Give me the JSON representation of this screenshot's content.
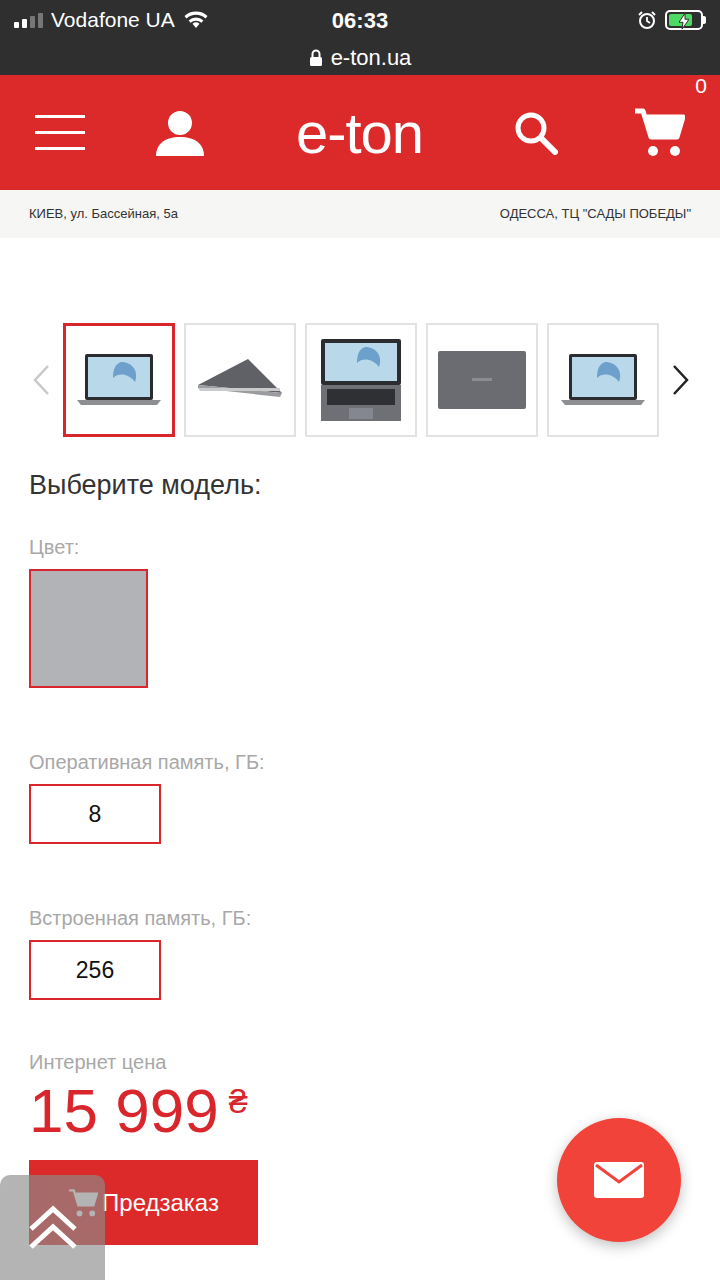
{
  "status_bar": {
    "carrier": "Vodafone UA",
    "time": "06:33",
    "url": "e-ton.ua",
    "signal_level": 0.5,
    "battery_level": 0.75,
    "charging": true,
    "alarm": true
  },
  "header": {
    "logo": "e-ton",
    "cart_count": "0"
  },
  "stores": [
    {
      "label": "КИЕВ, ул. Бассейная, 5а"
    },
    {
      "label": "ОДЕССА, ТЦ \"САДЫ ПОБЕДЫ\""
    }
  ],
  "gallery": {
    "prev_disabled": true,
    "next_disabled": false,
    "thumbnails": [
      {
        "kind": "front",
        "selected": true
      },
      {
        "kind": "side",
        "selected": false
      },
      {
        "kind": "top",
        "selected": false
      },
      {
        "kind": "lid",
        "selected": false
      },
      {
        "kind": "front",
        "selected": false
      }
    ]
  },
  "model": {
    "heading": "Выберите модель:",
    "options": [
      {
        "label": "Цвет:",
        "kind": "swatch",
        "values": [
          {
            "color": "#b1b3b6",
            "selected": true
          }
        ]
      },
      {
        "label": "Оперативная память, ГБ:",
        "kind": "text",
        "values": [
          {
            "text": "8",
            "selected": true
          }
        ]
      },
      {
        "label": "Встроенная память, ГБ:",
        "kind": "text",
        "values": [
          {
            "text": "256",
            "selected": true
          }
        ]
      }
    ]
  },
  "price": {
    "label": "Интернет цена",
    "amount": "15 999",
    "currency": "₴"
  },
  "preorder_button": {
    "label": "Предзаказ"
  }
}
